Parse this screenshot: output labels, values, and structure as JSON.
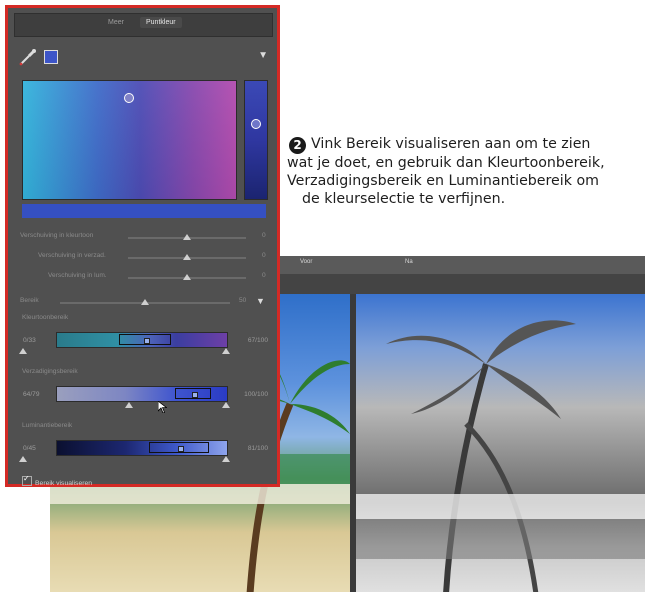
{
  "annotation": {
    "step": "2",
    "line1": "Vink Bereik visualiseren aan om te zien",
    "line2": "wat je doet, en gebruik dan Kleurtoonbereik,",
    "line3": "Verzadigingsbereik en Luminantiebereik om",
    "line4": "de kleurselectie te verfijnen."
  },
  "compare": {
    "left_label": "Voor",
    "right_label": "Na"
  },
  "panel": {
    "tabs": [
      "Meer",
      "Puntkleur"
    ],
    "active_tab": "Puntkleur",
    "swatch_color": "#3d55c8",
    "sliders": [
      {
        "label": "Verschuiving in kleurtoon",
        "value": "0",
        "position": 0.5
      },
      {
        "label": "Verschuiving in verzad.",
        "value": "0",
        "position": 0.5
      },
      {
        "label": "Verschuiving in lum.",
        "value": "0",
        "position": 0.5
      }
    ],
    "range": {
      "label": "Bereik",
      "value": "50",
      "position": 0.5
    },
    "hue_range": {
      "label": "Kleurtoonbereik",
      "left": "0/33",
      "right": "67/100"
    },
    "sat_range": {
      "label": "Verzadigingsbereik",
      "left": "64/79",
      "right": "100/100"
    },
    "lum_range": {
      "label": "Luminantiebereik",
      "left": "0/45",
      "right": "81/100"
    },
    "visualize": {
      "label": "Bereik visualiseren",
      "checked": true
    }
  },
  "colors": {
    "panel_border": "#d42a25",
    "panel_bg": "#505050",
    "accent_blue": "#3550c2"
  }
}
